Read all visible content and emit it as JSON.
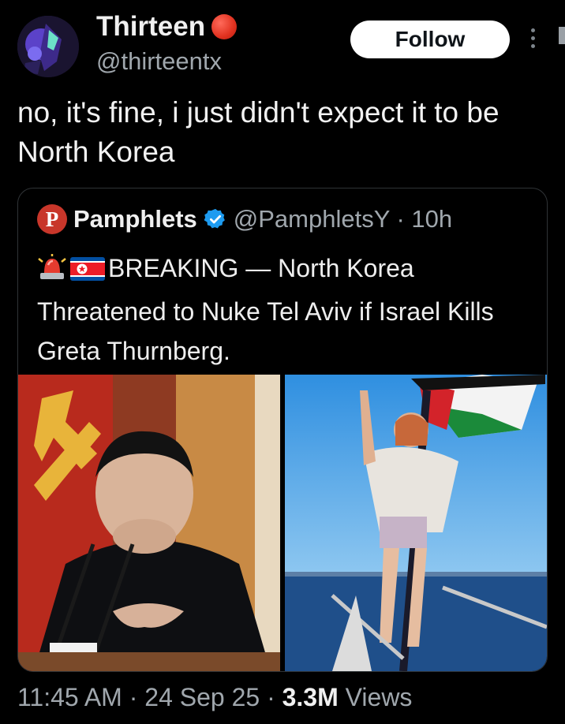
{
  "author": {
    "name": "Thirteen",
    "handle": "@thirteentx",
    "follow_label": "Follow"
  },
  "tweet": {
    "text": "no, it's fine, i just didn't expect it to be North Korea"
  },
  "quoted": {
    "logo_letter": "P",
    "name": "Pamphlets",
    "handle": "@PamphletsY",
    "separator": " · ",
    "time": "10h",
    "body": "BREAKING — North Korea Threatened to Nuke Tel Aviv if Israel Kills Greta Thurnberg.",
    "emoji_icons": [
      "rotating-light-icon",
      "north-korea-flag-icon"
    ]
  },
  "footer": {
    "time": "11:45 AM",
    "sep1": " · ",
    "date": "24 Sep 25",
    "sep2": " · ",
    "views_count": "3.3M",
    "views_label": " Views"
  },
  "colors": {
    "background": "#000000",
    "accent_verified": "#1d9bf0",
    "status_dot": "#e0311f",
    "pamphlets_logo": "#c8362a"
  }
}
